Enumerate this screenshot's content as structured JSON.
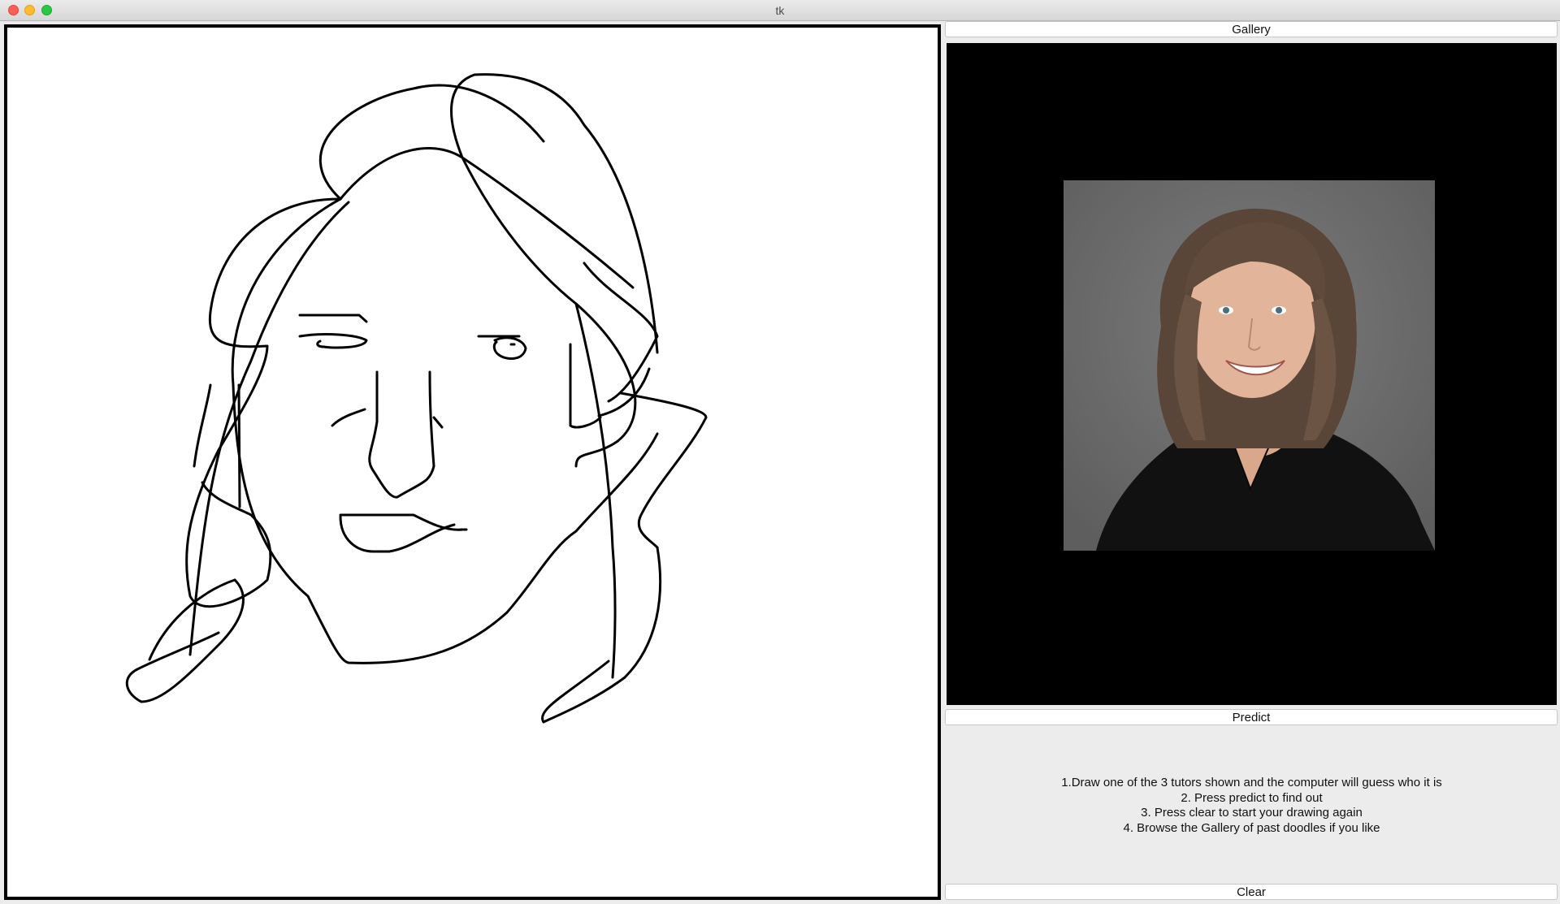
{
  "window": {
    "title": "tk"
  },
  "gallery_button": {
    "label": "Gallery"
  },
  "predict_button": {
    "label": "Predict"
  },
  "clear_button": {
    "label": "Clear"
  },
  "instructions": [
    "1.Draw one of the 3 tutors shown and the computer will guess who it is",
    "2. Press predict to find out",
    "3. Press clear to start your drawing again",
    "4. Browse the Gallery of past doodles if you like"
  ],
  "colors": {
    "canvas_background": "#ffffff",
    "stroke": "#000000",
    "gallery_background": "#000000",
    "window_background": "#ececec"
  }
}
